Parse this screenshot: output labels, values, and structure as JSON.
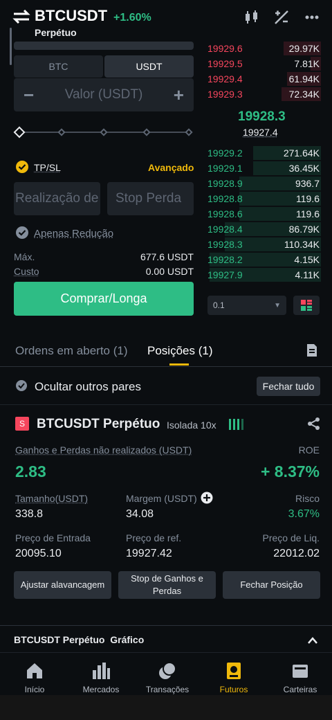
{
  "header": {
    "symbol": "BTCUSDT",
    "change": "+1.60%",
    "subtitle": "Perpétuo"
  },
  "order_form": {
    "toggle_left": "BTC",
    "toggle_right": "USDT",
    "amount_placeholder": "Valor (USDT)",
    "minus": "−",
    "plus": "+",
    "tpsl_label": "TP/SL",
    "advanced_label": "Avançado",
    "take_profit_placeholder": "Realização de",
    "stop_loss_placeholder": "Stop Perda",
    "reduce_only_label": "Apenas Redução",
    "max_label": "Máx.",
    "max_value": "677.6 USDT",
    "cost_label": "Custo",
    "cost_value": "0.00 USDT",
    "buy_button": "Comprar/Longa"
  },
  "order_book": {
    "asks": [
      {
        "price": "19929.6",
        "qty": "29.97K",
        "depth": 0.33
      },
      {
        "price": "19929.5",
        "qty": "7.81K",
        "depth": 0.09
      },
      {
        "price": "19929.4",
        "qty": "61.94K",
        "depth": 0.3
      },
      {
        "price": "19929.3",
        "qty": "72.34K",
        "depth": 0.35
      }
    ],
    "last_price": "19928.3",
    "mark_price": "19927.4",
    "bids": [
      {
        "price": "19929.2",
        "qty": "271.64K",
        "depth": 0.6
      },
      {
        "price": "19929.1",
        "qty": "36.45K",
        "depth": 0.6
      },
      {
        "price": "19928.9",
        "qty": "936.7",
        "depth": 0.72
      },
      {
        "price": "19928.8",
        "qty": "119.6",
        "depth": 0.72
      },
      {
        "price": "19928.6",
        "qty": "119.6",
        "depth": 0.72
      },
      {
        "price": "19928.4",
        "qty": "86.79K",
        "depth": 0.85
      },
      {
        "price": "19928.3",
        "qty": "110.34K",
        "depth": 0.85
      },
      {
        "price": "19928.2",
        "qty": "4.15K",
        "depth": 0.98
      },
      {
        "price": "19927.9",
        "qty": "4.11K",
        "depth": 0.98
      }
    ],
    "precision": "0.1"
  },
  "tabs": {
    "open_orders": "Ordens em aberto (1)",
    "positions": "Posições (1)"
  },
  "position_filter": {
    "hide_other_pairs": "Ocultar outros pares",
    "close_all": "Fechar tudo"
  },
  "position": {
    "side_badge": "S",
    "symbol": "BTCUSDT Perpétuo",
    "margin_mode": "Isolada 10x",
    "pnl_label": "Ganhos e Perdas não realizados (USDT)",
    "pnl_value": "2.83",
    "roe_label": "ROE",
    "roe_value": "+ 8.37%",
    "size_label": "Tamanho(USDT)",
    "size_value": "338.8",
    "margin_label": "Margem (USDT)",
    "margin_value": "34.08",
    "risk_label": "Risco",
    "risk_value": "3.67%",
    "entry_label": "Preço de Entrada",
    "entry_value": "20095.10",
    "ref_label": "Preço de ref.",
    "ref_value": "19927.42",
    "liq_label": "Preço de Liq.",
    "liq_value": "22012.02",
    "btn_leverage": "Ajustar alavancagem",
    "btn_tpsl": "Stop de Ganhos e Perdas",
    "btn_close": "Fechar Posição"
  },
  "chart_section": {
    "title": "BTCUSDT Perpétuo  Gráfico"
  },
  "nav": {
    "items": [
      {
        "label": "Início",
        "icon": "home-icon"
      },
      {
        "label": "Mercados",
        "icon": "markets-icon"
      },
      {
        "label": "Transações",
        "icon": "trade-icon"
      },
      {
        "label": "Futuros",
        "icon": "futures-icon",
        "active": true
      },
      {
        "label": "Carteiras",
        "icon": "wallet-icon"
      }
    ]
  },
  "colors": {
    "green": "#2ebd85",
    "red": "#f6465d",
    "yellow": "#f0b90b",
    "bg": "#0b0e11"
  }
}
